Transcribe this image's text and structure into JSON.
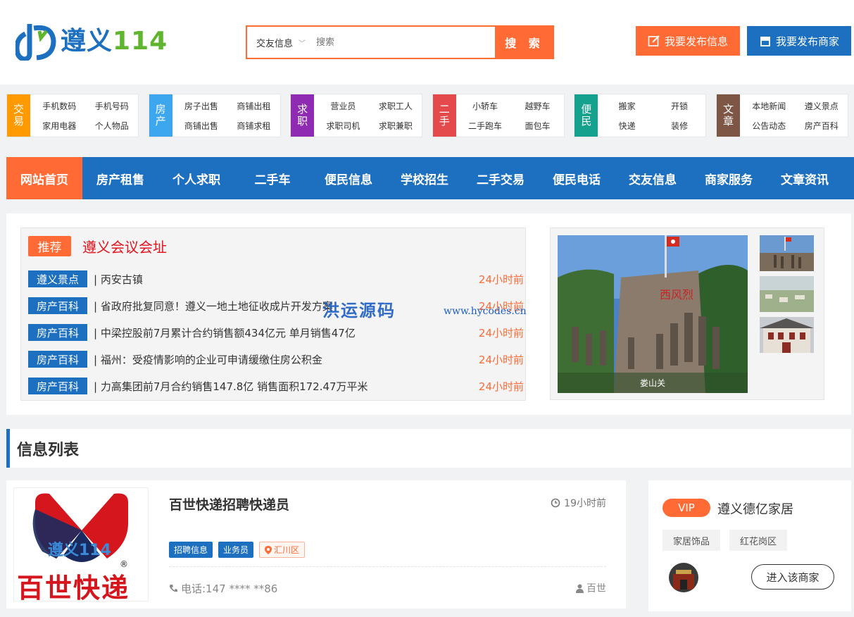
{
  "brand": {
    "name_part1": "遵义",
    "name_part2": "114"
  },
  "search": {
    "category": "交友信息",
    "placeholder": "搜索",
    "button": "搜 索"
  },
  "header_buttons": {
    "publish_info": "我要发布信息",
    "publish_merchant": "我要发布商家"
  },
  "categories": [
    {
      "tag": "交易",
      "color": "#ff9a02",
      "links": [
        "手机数码",
        "手机号码",
        "家用电器",
        "个人物品"
      ]
    },
    {
      "tag": "房产",
      "color": "#3ca7ee",
      "links": [
        "房子出售",
        "商铺出租",
        "商铺出售",
        "商铺求租"
      ]
    },
    {
      "tag": "求职",
      "color": "#8e2bb2",
      "links": [
        "营业员",
        "求职工人",
        "求职司机",
        "求职兼职"
      ]
    },
    {
      "tag": "二手",
      "color": "#e44a4b",
      "links": [
        "小轿车",
        "越野车",
        "二手跑车",
        "面包车"
      ]
    },
    {
      "tag": "便民",
      "color": "#14a28f",
      "links": [
        "搬家",
        "开锁",
        "快递",
        "装修"
      ]
    },
    {
      "tag": "文章",
      "color": "#7d5646",
      "links": [
        "本地新闻",
        "遵义景点",
        "公告动态",
        "房产百科"
      ]
    }
  ],
  "nav": [
    "网站首页",
    "房产租售",
    "个人求职",
    "二手车",
    "便民信息",
    "学校招生",
    "二手交易",
    "便民电话",
    "交友信息",
    "商家服务",
    "文章资讯"
  ],
  "featured": {
    "badge": "推荐",
    "title": "遵义会议会址"
  },
  "news": [
    {
      "label": "遵义景点",
      "text": "| 丙安古镇",
      "time": "24小时前"
    },
    {
      "label": "房产百科",
      "text": "| 省政府批复同意！遵义一地土地征收成片开发方案",
      "time": "24小时前"
    },
    {
      "label": "房产百科",
      "text": "| 中梁控股前7月累计合约销售额434亿元 单月销售47亿",
      "time": "24小时前"
    },
    {
      "label": "房产百科",
      "text": "| 福州：受疫情影响的企业可申请缓缴住房公积金",
      "time": "24小时前"
    },
    {
      "label": "房产百科",
      "text": "| 力高集团前7月合约销售147.8亿 销售面积172.47万平米",
      "time": "24小时前"
    }
  ],
  "gallery": {
    "caption": "娄山关",
    "monument_text": "西风烈"
  },
  "watermark": {
    "cn": "洪运源码",
    "url": "www.hycodes.cn"
  },
  "info_list": {
    "heading": "信息列表"
  },
  "listing": {
    "title": "百世快递招聘快递员",
    "time": "19小时前",
    "tags": [
      "招聘信息",
      "业务员",
      "汇川区"
    ],
    "phone": "电话:147 **** **86",
    "user": "百世",
    "logo_text": "百世快递",
    "logo_overlay": "遵义114"
  },
  "vip": {
    "badge": "VIP",
    "name": "遵义德亿家居",
    "tags": [
      "家居饰品",
      "红花岗区"
    ],
    "enter": "进入该商家"
  }
}
